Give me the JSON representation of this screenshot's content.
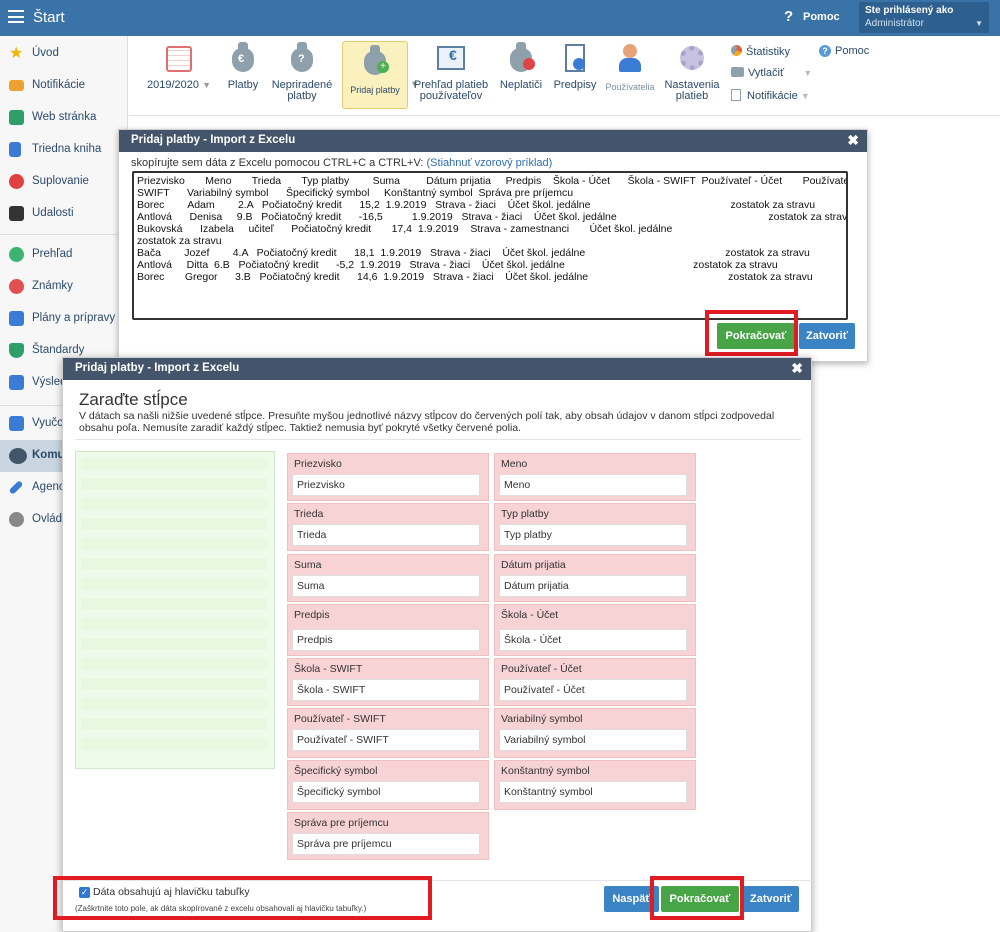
{
  "topbar": {
    "title": "Štart",
    "help": "Pomoc",
    "user_line1": "Ste prihlásený ako",
    "user_line2": "Administrátor"
  },
  "sidebar": {
    "items": [
      {
        "label": "Úvod",
        "color": "#f4b400"
      },
      {
        "label": "Notifikácie",
        "color": "#f0a030"
      },
      {
        "label": "Web stránka",
        "color": "#2e9e6a"
      },
      {
        "label": "Triedna kniha",
        "color": "#3a7bd5"
      },
      {
        "label": "Suplovanie",
        "color": "#e04040"
      },
      {
        "label": "Udalosti",
        "color": "#333333"
      },
      {
        "label": "Prehľad",
        "color": "#3cb371"
      },
      {
        "label": "Známky",
        "color": "#e05050"
      },
      {
        "label": "Plány a prípravy",
        "color": "#3a7bd5"
      },
      {
        "label": "Štandardy",
        "color": "#2e9e6a"
      },
      {
        "label": "Výsled",
        "color": "#3a7bd5"
      },
      {
        "label": "Vyučo",
        "color": "#3a7bd5"
      },
      {
        "label": "Komu",
        "color": "#44546a"
      },
      {
        "label": "Agenc",
        "color": "#3a7bd5"
      },
      {
        "label": "Ovlád",
        "color": "#888888"
      }
    ]
  },
  "toolbar": {
    "year": "2019/2020",
    "items": [
      {
        "label": "Platby"
      },
      {
        "label": "Nepriradené platby"
      },
      {
        "label": "Pridaj platby"
      },
      {
        "label": "Prehľad platieb používateľov"
      },
      {
        "label": "Neplatiči"
      },
      {
        "label": "Predpisy"
      },
      {
        "label": "Používatelia"
      },
      {
        "label": "Nastavenia platieb"
      }
    ],
    "side": [
      "Štatistiky",
      "Vytlačiť",
      "Notifikácie"
    ],
    "help": "Pomoc"
  },
  "modal1": {
    "title": "Pridaj platby - Import z Excelu",
    "instruction": "skopírujte sem dáta z Excelu pomocou CTRL+C a CTRL+V:",
    "link": "(Stiahnuť vzorový príklad)",
    "textarea": "Priezvisko       Meno       Trieda       Typ platby        Suma         Dátum prijatia     Predpis    Škola - Účet      Škola - SWIFT  Používateľ - Účet       Používateľ -\nSWIFT      Variabilný symbol      Špecifický symbol     Konštantný symbol  Správa pre príjemcu\nBorec        Adam        2.A   Počiatočný kredit      15,2  1.9.2019   Strava - žiaci    Účet škol. jedálne                                                zostatok za stravu\nAntlová      Denisa     9.B   Počiatočný kredit      -16,5          1.9.2019   Strava - žiaci    Účet škol. jedálne                                                    zostatok za stravu\nBukovská      Izabela     učiteľ      Počiatočný kredit       17,4  1.9.2019    Strava - zamestnanci       Účet škol. jedálne\nzostatok za stravu\nBača        Jozef        4.A   Počiatočný kredit      18,1  1.9.2019   Strava - žiaci    Účet škol. jedálne                                                zostatok za stravu\nAntlová     Ditta  6.B   Počiatočný kredit      -5,2  1.9.2019   Strava - žiaci    Účet škol. jedálne                                            zostatok za stravu\nBorec       Gregor      3.B   Počiatočný kredit      14,6  1.9.2019   Strava - žiaci    Účet škol. jedálne                                                zostatok za stravu",
    "btn_continue": "Pokračovať",
    "btn_close": "Zatvoriť"
  },
  "modal2": {
    "title": "Pridaj platby - Import z Excelu",
    "heading": "Zaraďte stĺpce",
    "description": "V dátach sa našli nižšie uvedené stĺpce. Presuňte myšou jednotlivé názvy stĺpcov do červených polí tak, aby obsah údajov v danom stĺpci zodpovedal obsahu poľa. Nemusíte zaradiť každý stĺpec. Taktiež nemusia byť pokryté všetky červené polia.",
    "fields": [
      {
        "label": "Priezvisko",
        "value": "Priezvisko"
      },
      {
        "label": "Meno",
        "value": "Meno"
      },
      {
        "label": "Trieda",
        "value": "Trieda"
      },
      {
        "label": "Typ platby",
        "value": "Typ platby"
      },
      {
        "label": "Suma",
        "value": "Suma"
      },
      {
        "label": "Dátum prijatia",
        "value": "Dátum prijatia"
      },
      {
        "label": "Predpis",
        "value": "Predpis"
      },
      {
        "label": "Škola - Účet",
        "value": "Škola - Účet"
      },
      {
        "label": "Škola - SWIFT",
        "value": "Škola - SWIFT"
      },
      {
        "label": "Používateľ - Účet",
        "value": "Používateľ - Účet"
      },
      {
        "label": "Používateľ - SWIFT",
        "value": "Používateľ - SWIFT"
      },
      {
        "label": "Variabilný symbol",
        "value": "Variabilný symbol"
      },
      {
        "label": "Špecifický symbol",
        "value": "Špecifický symbol"
      },
      {
        "label": "Konštantný symbol",
        "value": "Konštantný symbol"
      },
      {
        "label": "Správa pre príjemcu",
        "value": "Správa pre príjemcu"
      }
    ],
    "checkbox_label": "Dáta obsahujú aj hlavičku tabuľky",
    "checkbox_note": "(Zaškrtnite toto pole, ak dáta skopírované z excelu obsahovali aj hlavičku tabuľky.)",
    "btn_back": "Naspäť",
    "btn_continue": "Pokračovať",
    "btn_close": "Zatvoriť"
  }
}
